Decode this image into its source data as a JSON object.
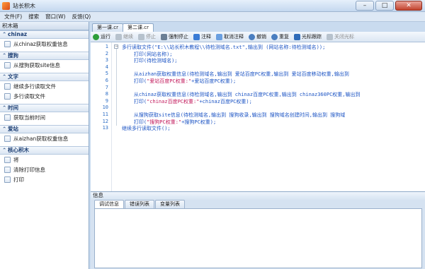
{
  "window": {
    "title": "站长积木"
  },
  "menu": [
    {
      "label": "文件(F)"
    },
    {
      "label": "搜索"
    },
    {
      "label": "窗口(W)"
    },
    {
      "label": "反馈(Q)"
    }
  ],
  "sidebar": {
    "title": "积木箱",
    "categories": [
      {
        "name": "chinaz",
        "items": [
          "从chinaz获取权重信息"
        ]
      },
      {
        "name": "搜狗",
        "items": [
          "从搜狗获取site信息"
        ]
      },
      {
        "name": "文字",
        "items": [
          "继续多行读取文件",
          "多行读取文件"
        ]
      },
      {
        "name": "时间",
        "items": [
          "获取当前时间"
        ]
      },
      {
        "name": "爱站",
        "items": [
          "从aizhan获取权重信息"
        ]
      },
      {
        "name": "核心积木",
        "items": [
          "将",
          "清除打印信息",
          "打印"
        ]
      }
    ]
  },
  "doc_tabs": [
    {
      "label": "第一课.cr"
    },
    {
      "label": "第二课.cr"
    }
  ],
  "toolbar": [
    {
      "label": "运行",
      "icon": "run-icon",
      "color": "#2e9e3a"
    },
    {
      "label": "继续",
      "icon": "continue-icon",
      "color": "#9aa8b6"
    },
    {
      "label": "停止",
      "icon": "stop-icon",
      "color": "#9aa8b6"
    },
    {
      "label": "强制停止",
      "icon": "force-stop-icon",
      "color": "#6b7f95"
    },
    {
      "label": "注释",
      "icon": "comment-icon",
      "color": "#3a7bd5"
    },
    {
      "label": "取消注释",
      "icon": "uncomment-icon",
      "color": "#6a9fe0"
    },
    {
      "label": "撤销",
      "icon": "undo-icon",
      "color": "#4a7ec0"
    },
    {
      "label": "重复",
      "icon": "redo-icon",
      "color": "#4a7ec0"
    },
    {
      "label": "光标跟踪",
      "icon": "cursor-track-icon",
      "color": "#2f6bb8"
    },
    {
      "label": "关闭光标",
      "icon": "cursor-off-icon",
      "color": "#9aa8b6"
    }
  ],
  "editor": {
    "lines": [
      {
        "n": "1",
        "text": "多行读取文件(\"E:\\\\站长积木教程\\\\待检测域名.txt\",输出到 (网站名称:待检测域名));",
        "kind": "kw"
      },
      {
        "n": "2",
        "text": "    打印(网站名称);",
        "kind": "kw"
      },
      {
        "n": "3",
        "text": "    打印(待检测域名);",
        "kind": "kw"
      },
      {
        "n": "4",
        "text": "",
        "kind": "plain"
      },
      {
        "n": "5",
        "text": "    从aizhan获取权重信息(待检测域名,输出到 爱站百度PC权重,输出到 爱站百度移动权重,输出到",
        "kind": "kw"
      },
      {
        "n": "6",
        "text": "    打印(\"爱站百度PC权重:\"+爱站百度PC权重);",
        "kind": "mix"
      },
      {
        "n": "7",
        "text": "",
        "kind": "plain"
      },
      {
        "n": "8",
        "text": "    从chinaz获取权重信息(待检测域名,输出到 chinaz百度PC权重,输出到 chinaz360PC权重,输出到",
        "kind": "kw"
      },
      {
        "n": "9",
        "text": "    打印(\"chinaz百度PC权重:\"+chinaz百度PC权重);",
        "kind": "mix"
      },
      {
        "n": "10",
        "text": "",
        "kind": "plain"
      },
      {
        "n": "11",
        "text": "    从搜狗获取site信息(待检测域名,输出到 搜狗收录,输出到 搜狗域名创建时间,输出到 搜狗域",
        "kind": "kw"
      },
      {
        "n": "12",
        "text": "    打印(\"搜狗PC权重:\"+搜狗PC权重);",
        "kind": "mix"
      },
      {
        "n": "13",
        "text": "继续多行读取文件();",
        "kind": "kw"
      }
    ]
  },
  "info": {
    "title": "信息",
    "tabs": [
      "调试信息",
      "错误列表",
      "变量列表"
    ]
  }
}
